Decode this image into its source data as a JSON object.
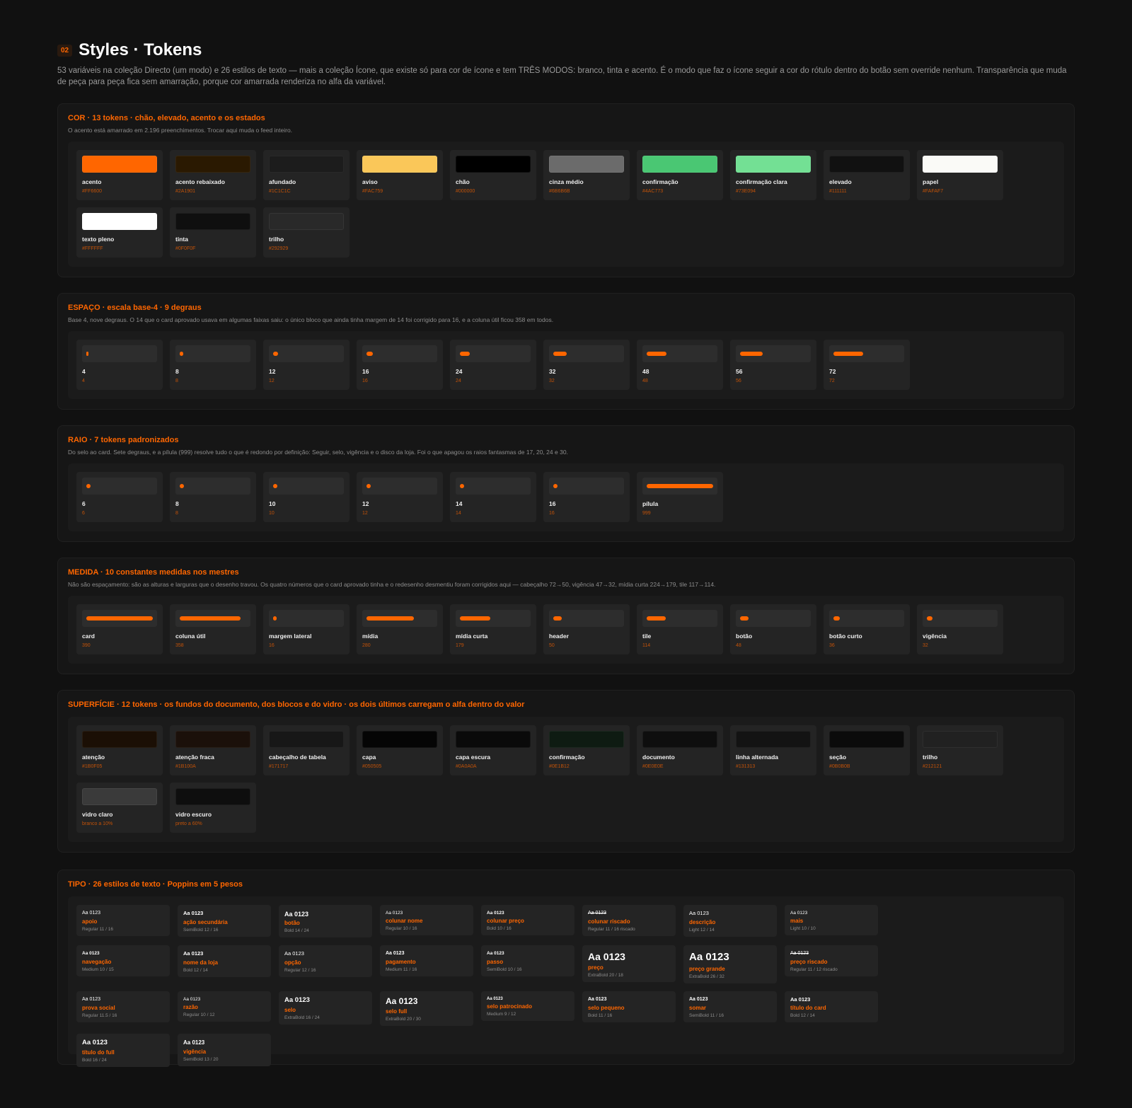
{
  "header": {
    "badge": "02",
    "title": "Styles · Tokens",
    "intro": "53 variáveis na coleção Directo (um modo) e 26 estilos de texto — mais a coleção Ícone, que existe só para cor de ícone e tem TRÊS MODOS: branco, tinta e acento. É o modo que faz o ícone seguir a cor do rótulo dentro do botão sem override nenhum. Transparência que muda de peça para peça fica sem amarração, porque cor amarrada renderiza no alfa da variável."
  },
  "colors": {
    "accent": "#FF6600",
    "page_bg": "#111111",
    "card_bg": "#242424"
  },
  "cor": {
    "title": "COR · 13 tokens · chão, elevado, acento e os estados",
    "desc": "O acento está amarrado em 2.196 preenchimentos. Trocar aqui muda o feed inteiro.",
    "tokens": [
      {
        "name": "acento",
        "hex": "#FF6600"
      },
      {
        "name": "acento rebaixado",
        "hex": "#2A1901"
      },
      {
        "name": "afundado",
        "hex": "#1C1C1C"
      },
      {
        "name": "aviso",
        "hex": "#FAC759"
      },
      {
        "name": "chão",
        "hex": "#000000"
      },
      {
        "name": "cinza médio",
        "hex": "#6B6B6B"
      },
      {
        "name": "confirmação",
        "hex": "#4AC773"
      },
      {
        "name": "confirmação clara",
        "hex": "#73E094"
      },
      {
        "name": "elevado",
        "hex": "#111111"
      },
      {
        "name": "papel",
        "hex": "#FAFAF7"
      },
      {
        "name": "texto pleno",
        "hex": "#FFFFFF"
      },
      {
        "name": "tinta",
        "hex": "#0F0F0F"
      },
      {
        "name": "trilho",
        "hex": "#292929"
      }
    ]
  },
  "espaco": {
    "title": "ESPAÇO · escala base-4 · 9 degraus",
    "desc": "Base 4, nove degraus. O 14 que o card aprovado usava em algumas faixas saiu: o único bloco que ainda tinha margem de 14 foi corrigido para 16, e a coluna útil ficou 358 em todos.",
    "tokens": [
      {
        "name": "4",
        "value": "4",
        "n": 4
      },
      {
        "name": "8",
        "value": "8",
        "n": 8
      },
      {
        "name": "12",
        "value": "12",
        "n": 12
      },
      {
        "name": "16",
        "value": "16",
        "n": 16
      },
      {
        "name": "24",
        "value": "24",
        "n": 24
      },
      {
        "name": "32",
        "value": "32",
        "n": 32
      },
      {
        "name": "48",
        "value": "48",
        "n": 48
      },
      {
        "name": "56",
        "value": "56",
        "n": 56
      },
      {
        "name": "72",
        "value": "72",
        "n": 72
      }
    ]
  },
  "raio": {
    "title": "RAIO · 7 tokens padronizados",
    "desc": "Do selo ao card. Sete degraus, e a pílula (999) resolve tudo o que é redondo por definição: Seguir, selo, vigência e o disco da loja. Foi o que apagou os raios fantasmas de 17, 20, 24 e 30.",
    "tokens": [
      {
        "name": "6",
        "value": "6",
        "n": 6
      },
      {
        "name": "8",
        "value": "8",
        "n": 8
      },
      {
        "name": "10",
        "value": "10",
        "n": 10
      },
      {
        "name": "12",
        "value": "12",
        "n": 12
      },
      {
        "name": "14",
        "value": "14",
        "n": 14
      },
      {
        "name": "16",
        "value": "16",
        "n": 16
      },
      {
        "name": "pílula",
        "value": "999",
        "n": 999
      }
    ]
  },
  "medida": {
    "title": "MEDIDA · 10 constantes medidas nos mestres",
    "desc": "Não são espaçamento: são as alturas e larguras que o desenho travou. Os quatro números que o card aprovado tinha e o redesenho desmentiu foram corrigidos aqui — cabeçalho 72→50, vigência 47→32, mídia curta 224→179, tile 117→114.",
    "tokens": [
      {
        "name": "card",
        "value": "390",
        "n": 390
      },
      {
        "name": "coluna útil",
        "value": "358",
        "n": 358
      },
      {
        "name": "margem lateral",
        "value": "16",
        "n": 16
      },
      {
        "name": "mídia",
        "value": "280",
        "n": 280
      },
      {
        "name": "mídia curta",
        "value": "179",
        "n": 179
      },
      {
        "name": "header",
        "value": "50",
        "n": 50
      },
      {
        "name": "tile",
        "value": "114",
        "n": 114
      },
      {
        "name": "botão",
        "value": "48",
        "n": 48
      },
      {
        "name": "botão curto",
        "value": "36",
        "n": 36
      },
      {
        "name": "vigência",
        "value": "32",
        "n": 32
      }
    ]
  },
  "superficie": {
    "title": "SUPERFÍCIE · 12 tokens · os fundos do documento, dos blocos e do vidro · os dois últimos carregam o alfa dentro do valor",
    "tokens": [
      {
        "name": "atenção",
        "value": "#1B0F05",
        "color": "#1B0F05"
      },
      {
        "name": "atenção fraca",
        "value": "#1B100A",
        "color": "#1B100A"
      },
      {
        "name": "cabeçalho de tabela",
        "value": "#171717",
        "color": "#171717"
      },
      {
        "name": "capa",
        "value": "#050505",
        "color": "#050505"
      },
      {
        "name": "capa escura",
        "value": "#0A0A0A",
        "color": "#0A0A0A"
      },
      {
        "name": "confirmação",
        "value": "#0E1B12",
        "color": "#0E1B12"
      },
      {
        "name": "documento",
        "value": "#0E0E0E",
        "color": "#0E0E0E"
      },
      {
        "name": "linha alternada",
        "value": "#131313",
        "color": "#131313"
      },
      {
        "name": "seção",
        "value": "#0B0B0B",
        "color": "#0B0B0B"
      },
      {
        "name": "trilho",
        "value": "#212121",
        "color": "#212121"
      },
      {
        "name": "vidro claro",
        "value": "branco a 10%",
        "color": "#3A3A3A"
      },
      {
        "name": "vidro escuro",
        "value": "preto a 60%",
        "color": "#0E0E0E"
      }
    ]
  },
  "tipo": {
    "title": "TIPO · 26 estilos de texto · Poppins em 5 pesos",
    "sample": "Aa 0123",
    "styles": [
      {
        "name": "apoio",
        "spec": "Regular 11 / 16",
        "size": 7,
        "weight": "normal",
        "strike": false
      },
      {
        "name": "ação secundária",
        "spec": "SemiBold 12 / 16",
        "size": 7.5,
        "weight": "bold",
        "strike": false
      },
      {
        "name": "botão",
        "spec": "Bold 14 / 24",
        "size": 9,
        "weight": "bold",
        "strike": false
      },
      {
        "name": "colunar nome",
        "spec": "Regular 10 / 16",
        "size": 6.5,
        "weight": "normal",
        "strike": false
      },
      {
        "name": "colunar preço",
        "spec": "Bold 10 / 16",
        "size": 6.5,
        "weight": "bold",
        "strike": false
      },
      {
        "name": "colunar riscado",
        "spec": "Regular 11 / 16 riscado",
        "size": 7,
        "weight": "normal",
        "strike": true
      },
      {
        "name": "descrição",
        "spec": "Light 12 / 14",
        "size": 7.5,
        "weight": "normal",
        "strike": false
      },
      {
        "name": "mais",
        "spec": "Light 10 / 10",
        "size": 6.5,
        "weight": "normal",
        "strike": false
      },
      {
        "name": "navegação",
        "spec": "Medium 10 / 15",
        "size": 6.5,
        "weight": "bold",
        "strike": false
      },
      {
        "name": "nome da loja",
        "spec": "Bold 12 / 14",
        "size": 7.5,
        "weight": "bold",
        "strike": false
      },
      {
        "name": "opção",
        "spec": "Regular 12 / 16",
        "size": 7.5,
        "weight": "normal",
        "strike": false
      },
      {
        "name": "pagamento",
        "spec": "Medium 11 / 16",
        "size": 7,
        "weight": "bold",
        "strike": false
      },
      {
        "name": "passo",
        "spec": "SemiBold 10 / 16",
        "size": 6.5,
        "weight": "bold",
        "strike": false
      },
      {
        "name": "preço",
        "spec": "ExtraBold 20 / 18",
        "size": 14,
        "weight": "bold",
        "strike": false
      },
      {
        "name": "preço grande",
        "spec": "ExtraBold 26 / 32",
        "size": 15,
        "weight": "bold",
        "strike": false
      },
      {
        "name": "preço riscado",
        "spec": "Regular 11 / 12 riscado",
        "size": 7,
        "weight": "normal",
        "strike": true
      },
      {
        "name": "prova social",
        "spec": "Regular 11.5 / 16",
        "size": 7,
        "weight": "normal",
        "strike": false
      },
      {
        "name": "razão",
        "spec": "Regular 10 / 12",
        "size": 6.5,
        "weight": "normal",
        "strike": false
      },
      {
        "name": "selo",
        "spec": "ExtraBold 16 / 24",
        "size": 9.5,
        "weight": "bold",
        "strike": false
      },
      {
        "name": "selo full",
        "spec": "ExtraBold 20 / 30",
        "size": 12,
        "weight": "bold",
        "strike": false
      },
      {
        "name": "selo patrocinado",
        "spec": "Medium 9 / 12",
        "size": 6,
        "weight": "bold",
        "strike": false
      },
      {
        "name": "selo pequeno",
        "spec": "Bold 11 / 16",
        "size": 7,
        "weight": "bold",
        "strike": false
      },
      {
        "name": "somar",
        "spec": "SemiBold 11 / 16",
        "size": 7,
        "weight": "bold",
        "strike": false
      },
      {
        "name": "título do card",
        "spec": "Bold 12 / 14",
        "size": 7.5,
        "weight": "bold",
        "strike": false
      },
      {
        "name": "título do full",
        "spec": "Bold 16 / 24",
        "size": 9.5,
        "weight": "bold",
        "strike": false
      },
      {
        "name": "vigência",
        "spec": "SemiBold 13 / 20",
        "size": 8,
        "weight": "bold",
        "strike": false
      }
    ]
  }
}
